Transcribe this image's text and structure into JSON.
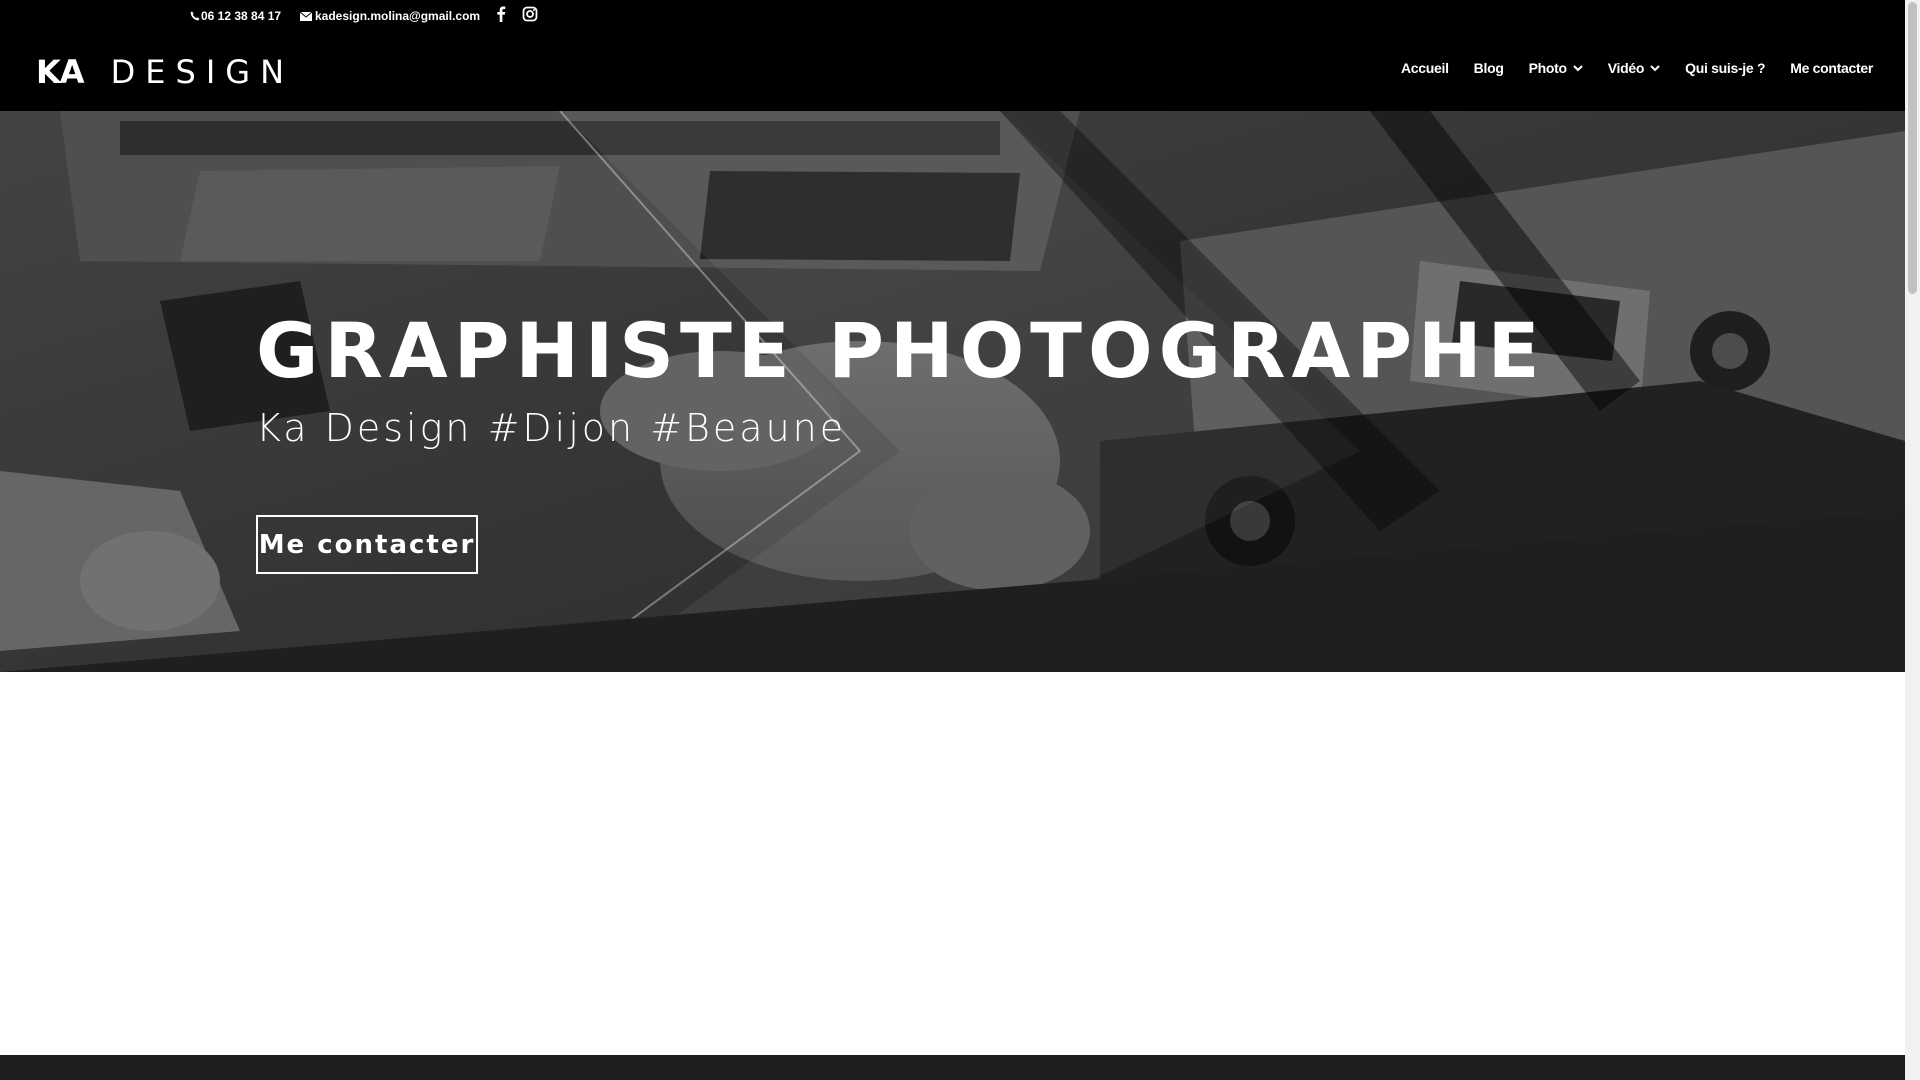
{
  "topbar": {
    "phone": "06 12 38 84 17",
    "email": "kadesign.molina@gmail.com",
    "icons": [
      "phone-icon",
      "mail-icon",
      "facebook-icon",
      "instagram-icon"
    ]
  },
  "header": {
    "logo_ka": "KA",
    "logo_design": "DESIGN",
    "nav": [
      {
        "label": "Accueil",
        "has_dropdown": false
      },
      {
        "label": "Blog",
        "has_dropdown": false
      },
      {
        "label": "Photo",
        "has_dropdown": true
      },
      {
        "label": "Vidéo",
        "has_dropdown": true
      },
      {
        "label": "Qui suis-je ?",
        "has_dropdown": false
      },
      {
        "label": "Me contacter",
        "has_dropdown": false
      }
    ]
  },
  "hero": {
    "title": "GRAPHISTE PHOTOGRAPHE",
    "subtitle": "Ka Design #Dijon #Beaune",
    "button_label": "Me contacter"
  },
  "colors": {
    "topbar_bg": "#000000",
    "header_bg": "#000000",
    "hero_dark": "#1f1f1f",
    "text": "#ffffff"
  }
}
